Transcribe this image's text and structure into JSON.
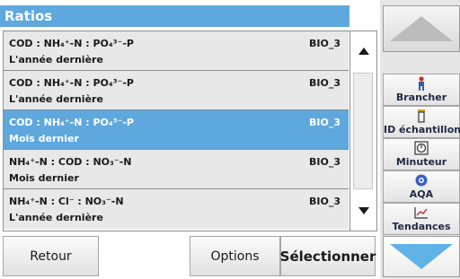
{
  "header": {
    "title": "Ratios"
  },
  "list": {
    "items": [
      {
        "formula": "COD : NH₄⁺-N : PO₄³⁻-P",
        "period": "L'année dernière",
        "code": "BIO_3",
        "selected": false
      },
      {
        "formula": "COD : NH₄⁺-N : PO₄³⁻-P",
        "period": "L'année dernière",
        "code": "BIO_3",
        "selected": false
      },
      {
        "formula": "COD : NH₄⁺-N : PO₄³⁻-P",
        "period": "Mois dernier",
        "code": "BIO_3",
        "selected": true
      },
      {
        "formula": "NH₄⁺-N : COD : NO₃⁻-N",
        "period": "Mois dernier",
        "code": "BIO_3",
        "selected": false
      },
      {
        "formula": "NH₄⁺-N : Cl⁻ : NO₃⁻-N",
        "period": "L'année dernière",
        "code": "BIO_3",
        "selected": false
      }
    ]
  },
  "sidebar": {
    "buttons": [
      {
        "label": "Brancher",
        "icon": "user-icon"
      },
      {
        "label": "ID échantillon",
        "icon": "sample-vial-icon"
      },
      {
        "label": "Minuteur",
        "icon": "timer-icon"
      },
      {
        "label": "AQA",
        "icon": "aqa-icon"
      },
      {
        "label": "Tendances",
        "icon": "trend-chart-icon"
      }
    ]
  },
  "footer": {
    "back_label": "Retour",
    "options_label": "Options",
    "select_label": "Sélectionner"
  },
  "colors": {
    "accent": "#5ea8de",
    "row_background": "#e8e8e8",
    "arrow_blue": "#5fb2e6",
    "arrow_gray": "#bcbcbc"
  }
}
